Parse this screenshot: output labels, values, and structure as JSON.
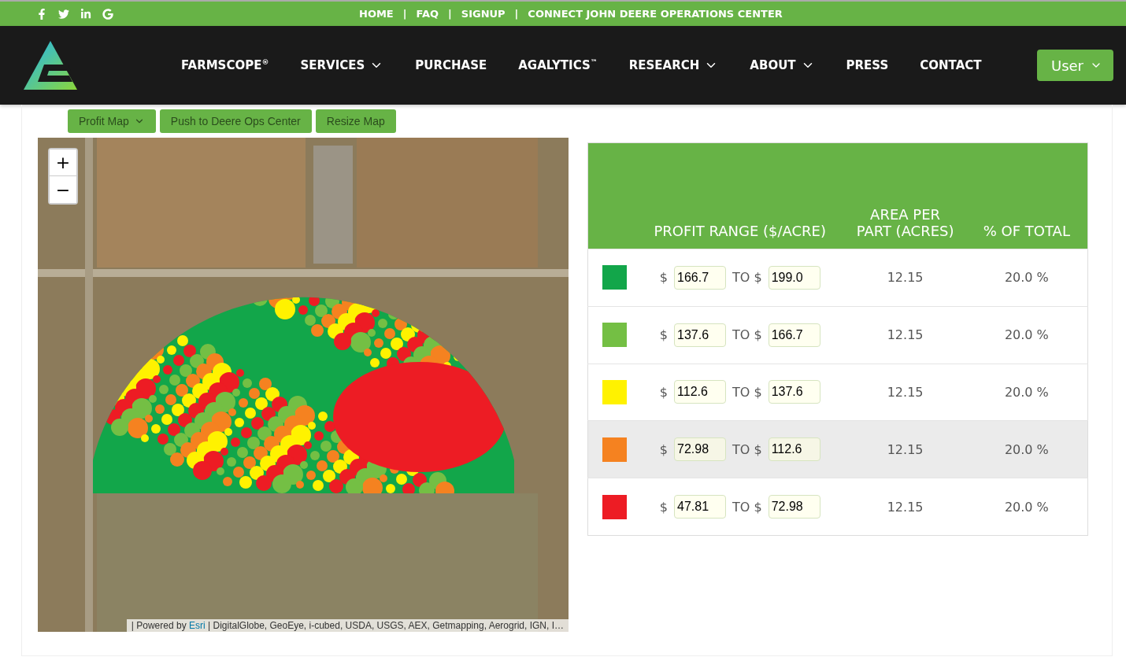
{
  "top_links": [
    "HOME",
    "FAQ",
    "SIGNUP",
    "CONNECT JOHN DEERE OPERATIONS CENTER"
  ],
  "top_link_separator": "|",
  "nav": {
    "items": [
      {
        "label": "FARMSCOPE$^{®}$",
        "has_menu": false
      },
      {
        "label": "SERVICES",
        "has_menu": true
      },
      {
        "label": "PURCHASE",
        "has_menu": false
      },
      {
        "label": "AGALYTICS$^{™}$",
        "has_menu": false
      },
      {
        "label": "RESEARCH",
        "has_menu": true
      },
      {
        "label": "ABOUT",
        "has_menu": true
      },
      {
        "label": "PRESS",
        "has_menu": false
      },
      {
        "label": "CONTACT",
        "has_menu": false
      }
    ],
    "user_button": "User"
  },
  "toolbar": [
    {
      "label": "Profit Map",
      "has_menu": true
    },
    {
      "label": "Push to Deere Ops Center",
      "has_menu": false
    },
    {
      "label": "Resize Map",
      "has_menu": false
    }
  ],
  "map": {
    "zoom_in": "+",
    "zoom_out": "−",
    "attribution": {
      "prefix": "| Powered by",
      "link": "Esri",
      "rest": "| DigitalGlobe, GeoEye, i-cubed, USDA, USGS, AEX, Getmapping, Aerogrid, IGN, I…"
    }
  },
  "table": {
    "columns": [
      "PROFIT RANGE ($/ACRE)",
      "AREA PER PART (ACRES)",
      "% OF TOTAL"
    ],
    "rows": [
      {
        "color": "#12a64a",
        "from_label": "$",
        "from": "166.7",
        "to_label": "TO $",
        "to": "199.0",
        "area": "12.15",
        "percent": "20.0 %",
        "highlighted": false
      },
      {
        "color": "#74bf44",
        "from_label": "$",
        "from": "137.6",
        "to_label": "TO $",
        "to": "166.7",
        "area": "12.15",
        "percent": "20.0 %",
        "highlighted": false
      },
      {
        "color": "#fff200",
        "from_label": "$",
        "from": "112.6",
        "to_label": "TO $",
        "to": "137.6",
        "area": "12.15",
        "percent": "20.0 %",
        "highlighted": false
      },
      {
        "color": "#f58220",
        "from_label": "$",
        "from": "72.98",
        "to_label": "TO $",
        "to": "112.6",
        "area": "12.15",
        "percent": "20.0 %",
        "highlighted": true
      },
      {
        "color": "#ed1c24",
        "from_label": "$",
        "from": "47.81",
        "to_label": "TO $",
        "to": "72.98",
        "area": "12.15",
        "percent": "20.0 %",
        "highlighted": false
      }
    ]
  }
}
